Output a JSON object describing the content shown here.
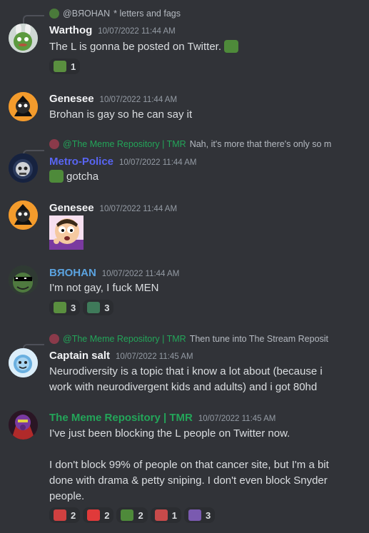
{
  "messages": [
    {
      "reply": {
        "author": "@BЯOHAN",
        "text": "* letters and fags",
        "author_color": "#b5bac1"
      },
      "author": "Warthog",
      "author_color": "#f2f3f5",
      "timestamp": "10/07/2022 11:44 AM",
      "lines": [
        "The L is gonna be posted on Twitter."
      ],
      "trailing_emoji": "pepe-emoji",
      "reactions": [
        {
          "emoji": "pepe-reaction",
          "count": "1"
        }
      ]
    },
    {
      "author": "Genesee",
      "author_color": "#f2f3f5",
      "timestamp": "10/07/2022 11:44 AM",
      "lines": [
        "Brohan is gay so he can say it"
      ]
    },
    {
      "reply": {
        "author": "@The Meme Repository | TMR",
        "text": "Nah, it's more that there's only so m",
        "author_color": "#23a559"
      },
      "author": "Metro-Police",
      "author_color": "#5865f2",
      "timestamp": "10/07/2022 11:44 AM",
      "leading_emoji": "pepe-emoji",
      "lines": [
        "gotcha"
      ]
    },
    {
      "author": "Genesee",
      "author_color": "#f2f3f5",
      "timestamp": "10/07/2022 11:44 AM",
      "big_emoji": "worried-face-emoji"
    },
    {
      "author": "BЯOHAN",
      "author_color": "#5ba3e0",
      "timestamp": "10/07/2022 11:44 AM",
      "lines": [
        "I'm not gay, I fuck MEN"
      ],
      "reactions": [
        {
          "emoji": "pepe-reaction",
          "count": "3"
        },
        {
          "emoji": "pepe-reaction",
          "count": "3"
        }
      ]
    },
    {
      "reply": {
        "author": "@The Meme Repository | TMR",
        "text": "Then tune into The Stream Reposit",
        "author_color": "#23a559"
      },
      "author": "Captain salt",
      "author_color": "#f2f3f5",
      "timestamp": "10/07/2022 11:45 AM",
      "lines": [
        "Neurodiversity is a topic that i know a lot about (because i",
        "work with neurodivergent kids and adults) and i got 80hd"
      ]
    },
    {
      "author": "The Meme Repository | TMR",
      "author_color": "#23a559",
      "timestamp": "10/07/2022 11:45 AM",
      "lines": [
        "I've just been blocking the L people on Twitter now.",
        "",
        "I don't block 99% of people on that cancer site, but I'm a bit",
        "done with drama & petty sniping. I don't even block Snyder",
        "people."
      ],
      "reactions": [
        {
          "emoji": "santa-reaction",
          "count": "2"
        },
        {
          "emoji": "hundred-reaction",
          "count": "2"
        },
        {
          "emoji": "pepe-reaction",
          "count": "2"
        },
        {
          "emoji": "santa-reaction",
          "count": "1"
        },
        {
          "emoji": "pepe-reaction",
          "count": "3"
        }
      ]
    }
  ],
  "colors": {
    "background": "#313338",
    "text": "#dbdee1",
    "muted": "#949ba4",
    "reaction_bg": "#2b2d31"
  }
}
